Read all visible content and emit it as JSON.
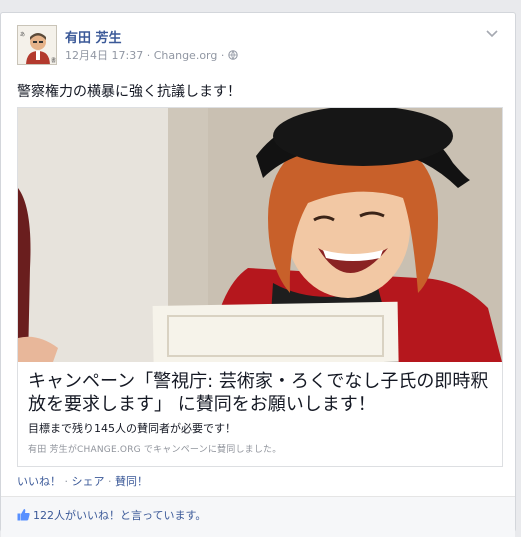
{
  "post": {
    "author": "有田 芳生",
    "date": "12月4日 17:37",
    "source": "Change.org",
    "separator": "·",
    "text": "警察権力の横暴に強く抗議します！"
  },
  "shared": {
    "title": "キャンペーン「警視庁: 芸術家・ろくでなし子氏の即時釈放を要求します」 に賛同をお願いします！",
    "subtitle": "目標まで残り145人の賛同者が必要です！",
    "caption": "有田 芳生がCHANGE.ORG でキャンペーンに賛同しました。"
  },
  "actions": {
    "like": "いいね！",
    "sep1": " · ",
    "share": "シェア",
    "sep2": " · ",
    "support": "賛同！"
  },
  "likes": {
    "text": "122人がいいね！と言っています。"
  },
  "colors": {
    "link": "#3b5998",
    "meta": "#9197a3",
    "background": "#e9eaed"
  },
  "icons": [
    "avatar",
    "globe-icon",
    "chevron-down-icon",
    "thumbs-up-icon"
  ]
}
